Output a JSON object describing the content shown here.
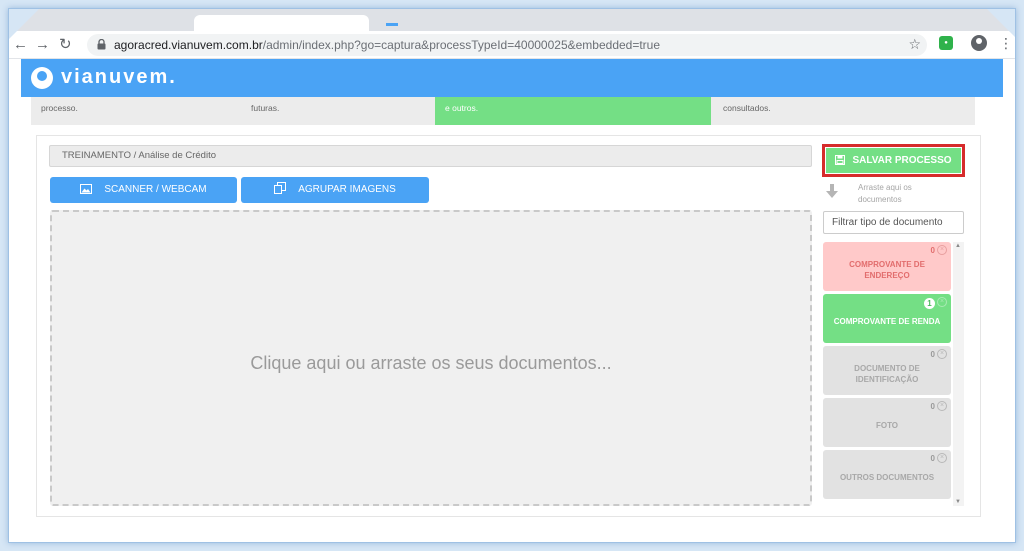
{
  "browser": {
    "url_host": "agoracred.vianuvem.com.br",
    "url_path": "/admin/index.php?go=captura&processTypeId=40000025&embedded=true"
  },
  "app": {
    "brand": "vianuvem."
  },
  "steps": [
    {
      "text": "processo."
    },
    {
      "text": "futuras."
    },
    {
      "text": "e outros."
    },
    {
      "text": "consultados."
    }
  ],
  "breadcrumb": "TREINAMENTO / Análise de Crédito",
  "buttons": {
    "scanner": "SCANNER / WEBCAM",
    "group": "AGRUPAR IMAGENS",
    "save": "SALVAR PROCESSO"
  },
  "dropzone": {
    "text": "Clique aqui ou arraste os seus documentos..."
  },
  "sidebar": {
    "drag_hint": "Arraste aqui os documentos",
    "filter_placeholder": "Filtrar tipo de documento"
  },
  "documents": [
    {
      "label": "COMPROVANTE DE ENDEREÇO",
      "count": "0",
      "state": "required"
    },
    {
      "label": "COMPROVANTE DE RENDA",
      "count": "1",
      "state": "done"
    },
    {
      "label": "DOCUMENTO DE IDENTIFICAÇÃO",
      "count": "0",
      "state": "optional"
    },
    {
      "label": "FOTO",
      "count": "0",
      "state": "optional"
    },
    {
      "label": "OUTROS DOCUMENTOS",
      "count": "0",
      "state": "optional"
    }
  ],
  "colors": {
    "primary": "#4aa3f5",
    "success": "#74df85",
    "danger_bg": "#ffc9c9",
    "highlight_border": "#d62b2b"
  }
}
